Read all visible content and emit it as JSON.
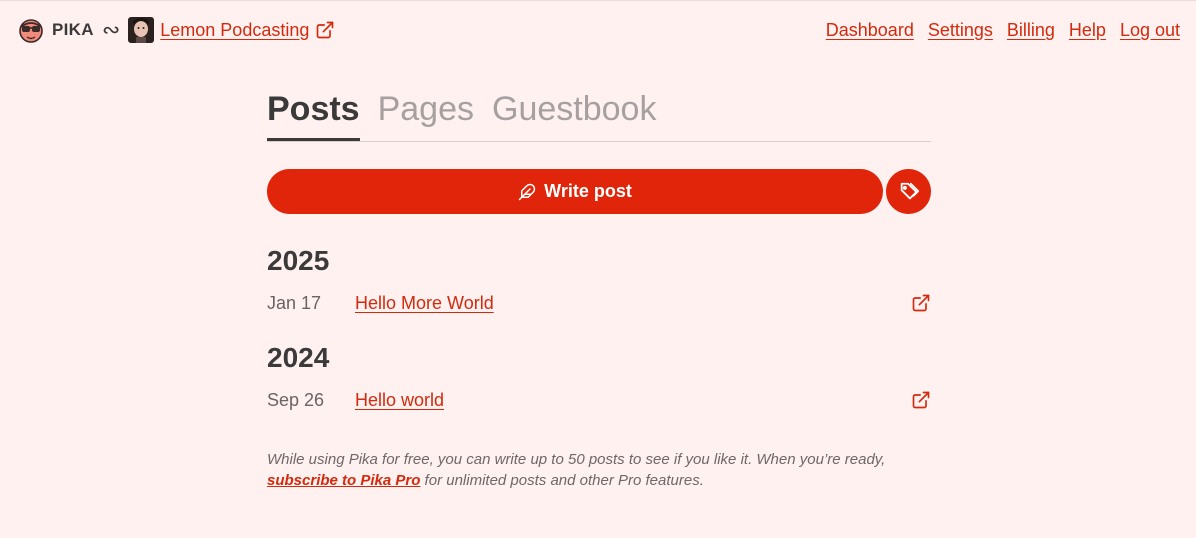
{
  "header": {
    "brand": "PIKA",
    "separator": "∾",
    "site_name": "Lemon Podcasting",
    "nav": [
      {
        "label": "Dashboard"
      },
      {
        "label": "Settings"
      },
      {
        "label": "Billing"
      },
      {
        "label": "Help"
      },
      {
        "label": "Log out"
      }
    ]
  },
  "tabs": [
    {
      "label": "Posts",
      "active": true
    },
    {
      "label": "Pages",
      "active": false
    },
    {
      "label": "Guestbook",
      "active": false
    }
  ],
  "actions": {
    "write_post_label": "Write post",
    "write_icon": "feather-icon",
    "tags_icon": "tags-icon"
  },
  "posts_by_year": [
    {
      "year": "2025",
      "posts": [
        {
          "date": "Jan 17",
          "title": "Hello More World"
        }
      ]
    },
    {
      "year": "2024",
      "posts": [
        {
          "date": "Sep 26",
          "title": "Hello world"
        }
      ]
    }
  ],
  "note": {
    "before": "While using Pika for free, you can write up to 50 posts to see if you like it. When you’re ready, ",
    "link": "subscribe to Pika Pro",
    "after": " for unlimited posts and other Pro features."
  },
  "colors": {
    "background": "#fff1ef",
    "accent": "#e0250a",
    "link": "#d22a0e",
    "text": "#3a3a3a"
  }
}
